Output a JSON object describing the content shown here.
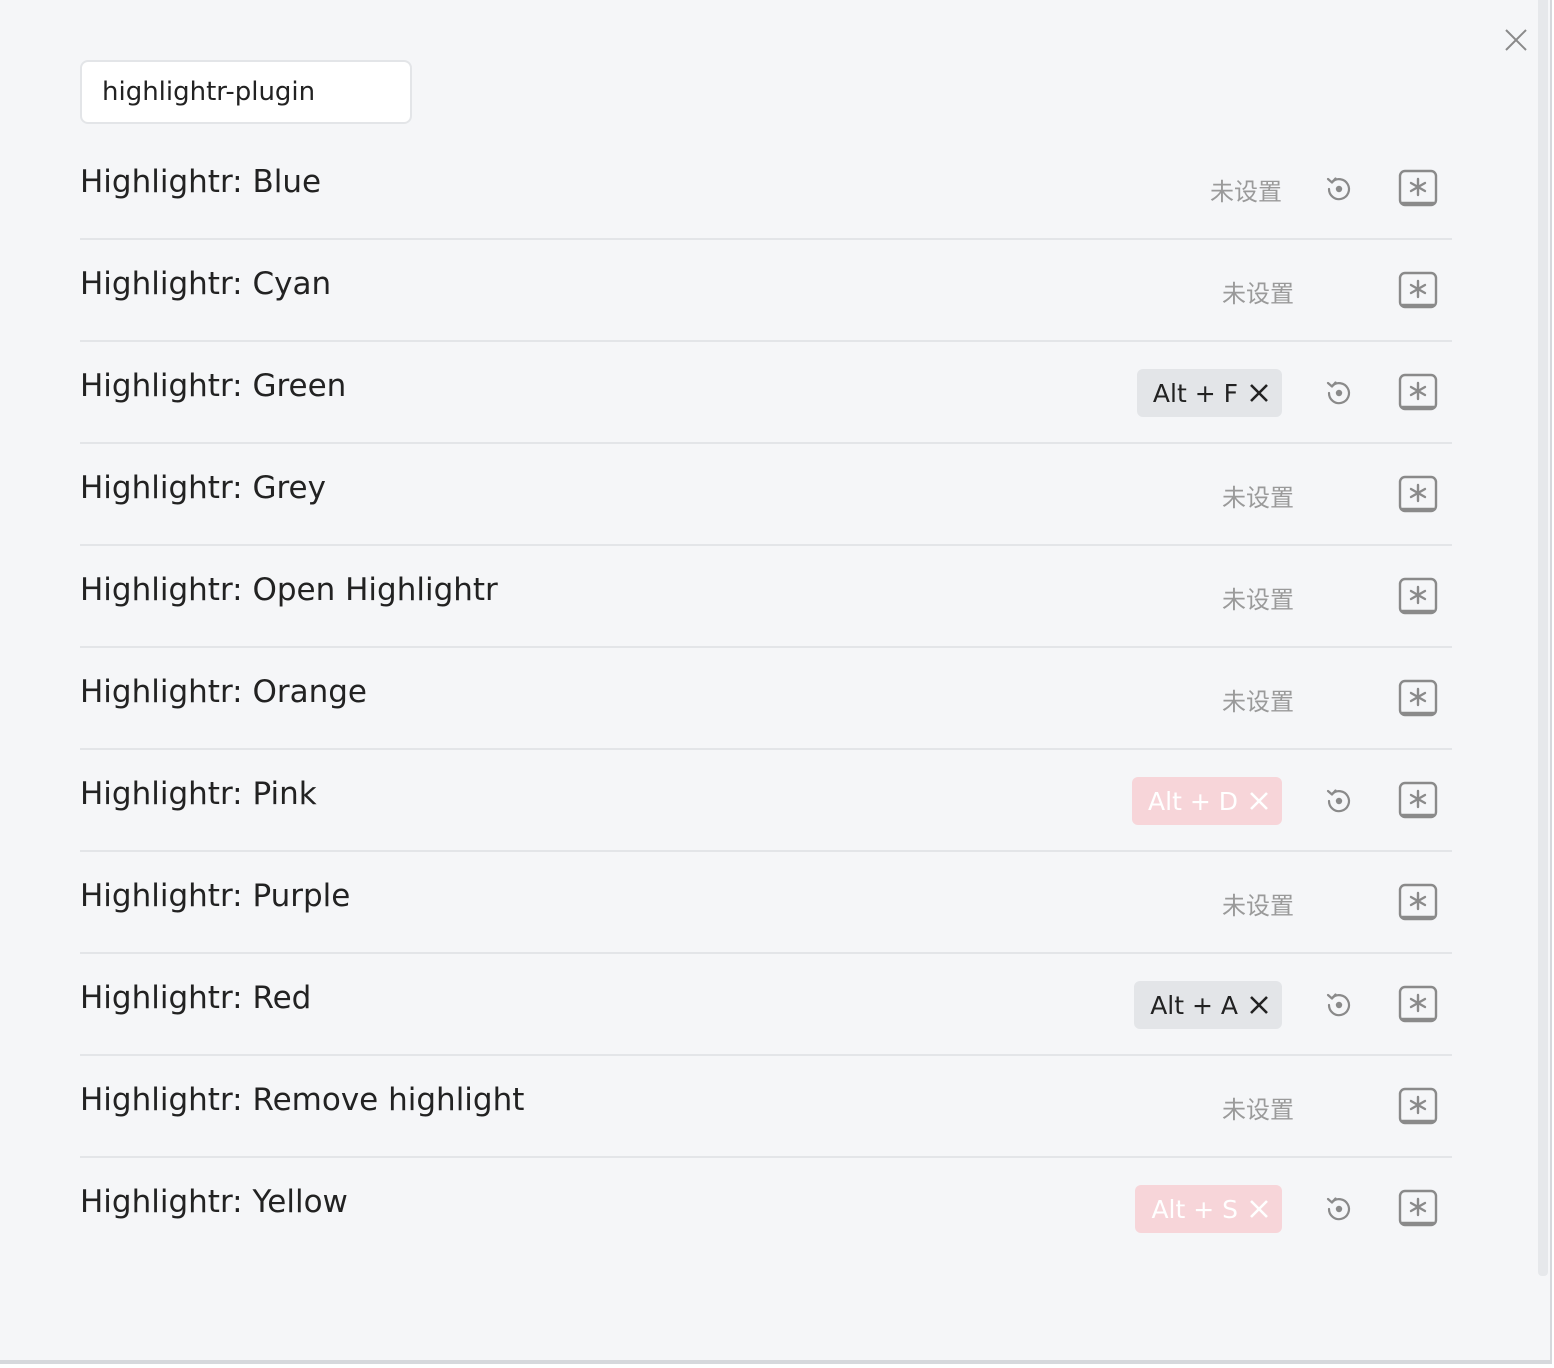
{
  "search": {
    "value": "highlightr-plugin"
  },
  "hotkeys": [
    {
      "name": "Highlightr: Blue",
      "status": "未设置",
      "hotkey": null,
      "conflict": false,
      "restore": true
    },
    {
      "name": "Highlightr: Cyan",
      "status": "未设置",
      "hotkey": null,
      "conflict": false,
      "restore": false
    },
    {
      "name": "Highlightr: Green",
      "status": null,
      "hotkey": "Alt + F",
      "conflict": false,
      "restore": true
    },
    {
      "name": "Highlightr: Grey",
      "status": "未设置",
      "hotkey": null,
      "conflict": false,
      "restore": false
    },
    {
      "name": "Highlightr: Open Highlightr",
      "status": "未设置",
      "hotkey": null,
      "conflict": false,
      "restore": false
    },
    {
      "name": "Highlightr: Orange",
      "status": "未设置",
      "hotkey": null,
      "conflict": false,
      "restore": false
    },
    {
      "name": "Highlightr: Pink",
      "status": null,
      "hotkey": "Alt + D",
      "conflict": true,
      "restore": true
    },
    {
      "name": "Highlightr: Purple",
      "status": "未设置",
      "hotkey": null,
      "conflict": false,
      "restore": false
    },
    {
      "name": "Highlightr: Red",
      "status": null,
      "hotkey": "Alt + A",
      "conflict": false,
      "restore": true
    },
    {
      "name": "Highlightr: Remove highlight",
      "status": "未设置",
      "hotkey": null,
      "conflict": false,
      "restore": false
    },
    {
      "name": "Highlightr: Yellow",
      "status": null,
      "hotkey": "Alt + S",
      "conflict": true,
      "restore": true
    }
  ],
  "colors": {
    "background": "#f5f6f8",
    "chip_normal": "#e3e5e8",
    "chip_conflict": "#f7d5d9",
    "text": "#222222",
    "muted": "#9a9a9a",
    "icon": "#8a8a8a"
  },
  "icons": {
    "close": "close-icon",
    "chip_remove": "remove-hotkey-icon",
    "restore": "restore-default-icon",
    "add": "add-hotkey-icon"
  }
}
